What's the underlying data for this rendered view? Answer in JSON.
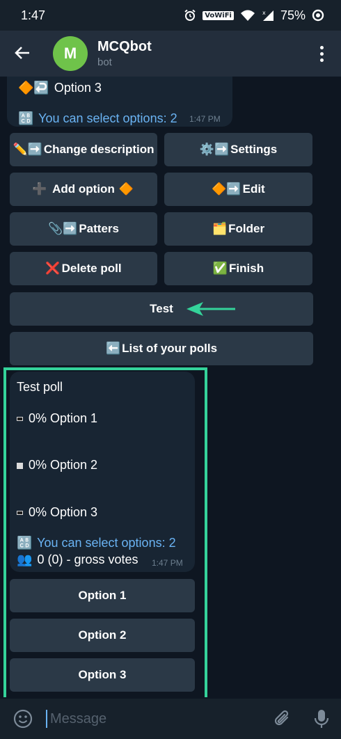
{
  "status": {
    "time": "1:47",
    "vowifi": "VoWiFi",
    "battery": "75%"
  },
  "header": {
    "back_icon": "arrow-left-icon",
    "avatar_letter": "M",
    "avatar_color": "#6fc34a",
    "title": "MCQbot",
    "subtitle": "bot"
  },
  "prev_message": {
    "option_text": "Option 3",
    "option_icons": "🔶↩️",
    "select_icon": "🔠",
    "select_text": "You can select options: 2",
    "time": "1:47 PM"
  },
  "keyboard": {
    "change_description": {
      "icon": "✏️➡️",
      "label": "Change description"
    },
    "settings": {
      "icon": "⚙️➡️",
      "label": "Settings"
    },
    "add_option": {
      "icon": "➕",
      "label": "Add option",
      "suffix_icon": "🔶"
    },
    "edit": {
      "icon": "🔶➡️",
      "label": "Edit"
    },
    "patters": {
      "icon": "📎➡️",
      "label": "Patters"
    },
    "folder": {
      "icon": "🗂️",
      "label": "Folder"
    },
    "delete_poll": {
      "icon": "❌",
      "label": "Delete poll"
    },
    "finish": {
      "icon": "✅",
      "label": "Finish"
    },
    "test": {
      "label": "Test"
    },
    "list_polls": {
      "icon": "⬅️",
      "label": "List of your polls"
    }
  },
  "poll": {
    "title": "Test poll",
    "options": [
      {
        "text": "0% Option 1"
      },
      {
        "text": "0% Option 2"
      },
      {
        "text": "0% Option 3"
      }
    ],
    "select_icon": "🔠",
    "select_text": "You can select options: 2",
    "votes_icon": "👥",
    "votes_text": "0 (0) - gross votes",
    "time": "1:47 PM"
  },
  "poll_buttons": [
    "Option 1",
    "Option 2",
    "Option 3"
  ],
  "composer": {
    "placeholder": "Message"
  },
  "colors": {
    "highlight": "#34d39a",
    "accent": "#6ab3f3",
    "background": "#0e1621"
  }
}
